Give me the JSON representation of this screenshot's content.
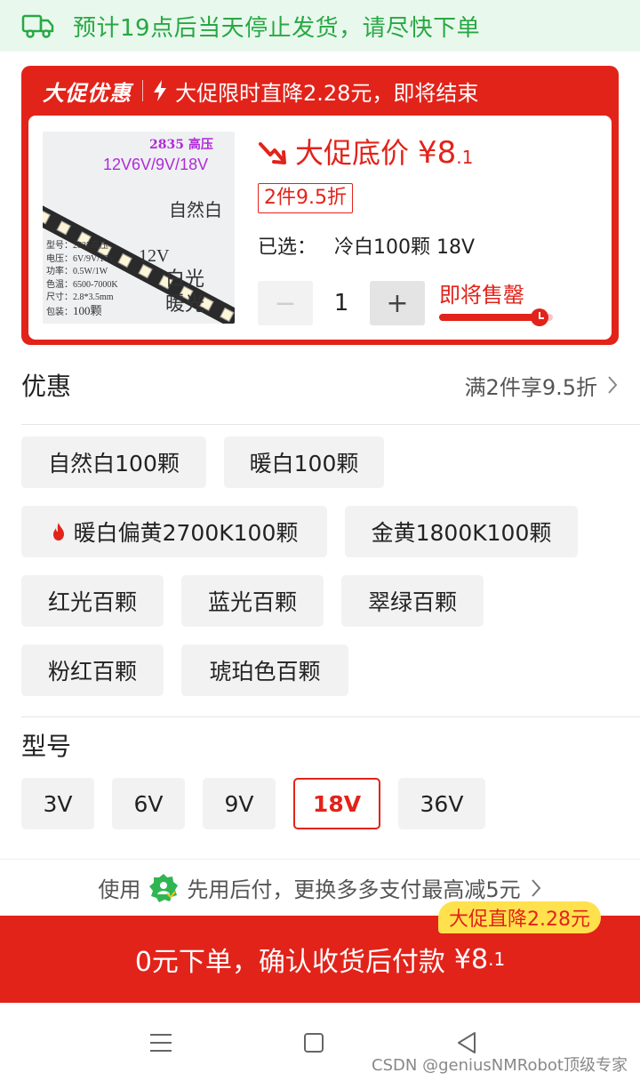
{
  "shipping": {
    "text": "预计19点后当天停止发货，请尽快下单",
    "icon": "truck-icon"
  },
  "promo": {
    "brand": "大促优惠",
    "headline": "大促限时直降2.28元，即将结束",
    "product_image": {
      "line1": "2835 高压",
      "line2": "12V6V/9V/18V",
      "color_label": "自然白",
      "specs": [
        "型号：2835高压",
        "电压：6V/9V/18V",
        "功率：0.5W/1W",
        "色温：6500-7000K",
        "尺寸：2.8*3.5mm",
        "包装："
      ],
      "count": "100颗",
      "voltage": "12V",
      "white": "白光",
      "warm": "暖光"
    },
    "price_label": "大促底价",
    "price_currency": "¥",
    "price_main": "8",
    "price_decimal": ".1",
    "discount": "2件9.5折",
    "selected_label": "已选：",
    "selected_value": "冷白100颗 18V",
    "quantity": "1",
    "minus": "−",
    "plus": "+",
    "stock_status": "即将售罄",
    "stock_level": 0.88
  },
  "offers": {
    "title": "优惠",
    "value": "满2件享9.5折"
  },
  "color_options": [
    {
      "label": "自然白100颗"
    },
    {
      "label": "暖白100颗"
    },
    {
      "label": "暖白偏黄2700K100颗",
      "hot": true
    },
    {
      "label": "金黄1800K100颗"
    },
    {
      "label": "红光百颗"
    },
    {
      "label": "蓝光百颗"
    },
    {
      "label": "翠绿百颗"
    },
    {
      "label": "粉红百颗"
    },
    {
      "label": "琥珀色百颗"
    }
  ],
  "model": {
    "title": "型号",
    "options": [
      {
        "label": "3V"
      },
      {
        "label": "6V"
      },
      {
        "label": "9V"
      },
      {
        "label": "18V",
        "selected": true
      },
      {
        "label": "36V"
      }
    ]
  },
  "payment": {
    "prefix": "使用",
    "text": "先用后付，更换多多支付最高减5元"
  },
  "buy": {
    "badge": "大促直降2.28元",
    "text": "0元下单，确认收货后付款",
    "price_main": "¥8",
    "price_decimal": ".1"
  },
  "watermark": "CSDN @geniusNMRobot顶级专家",
  "colors": {
    "brand_red": "#e2231a",
    "ship_green": "#27a844",
    "badge_yellow": "#ffe14d"
  }
}
